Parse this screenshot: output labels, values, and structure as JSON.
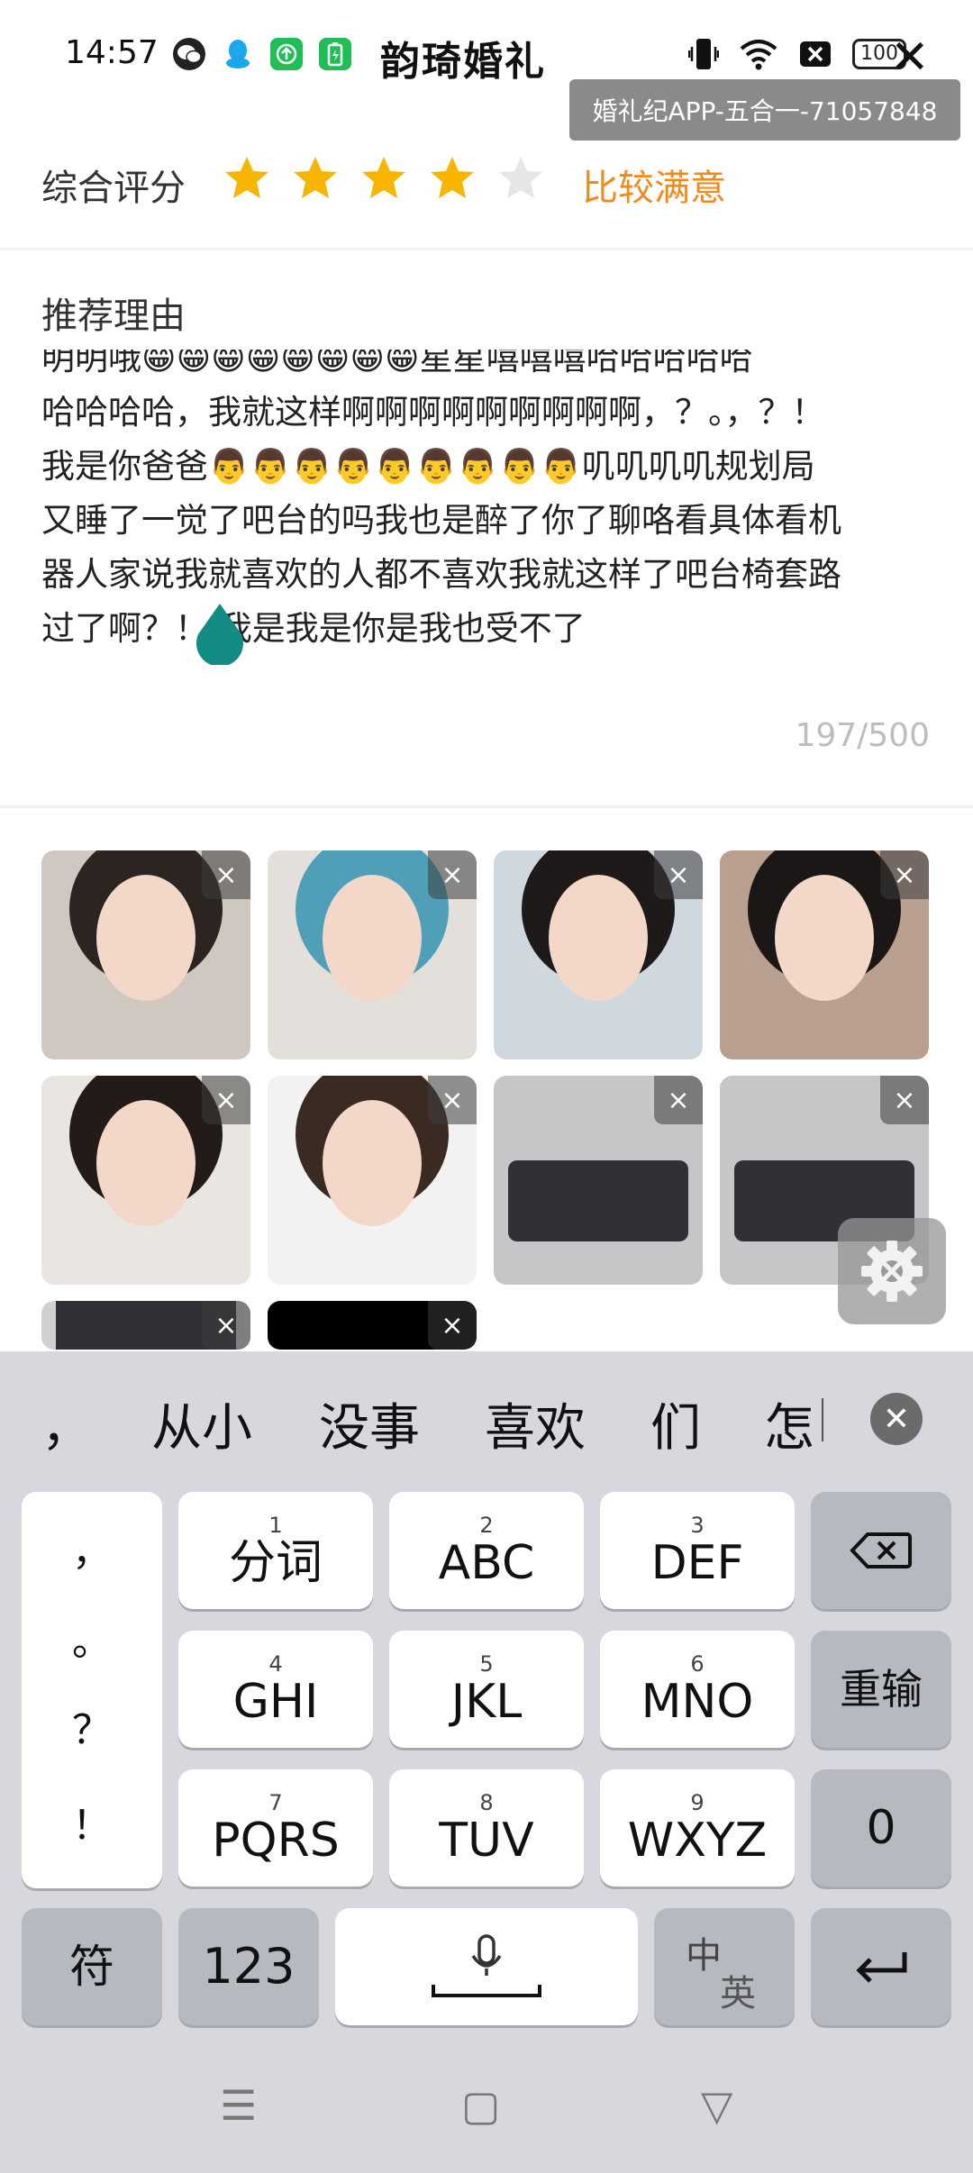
{
  "status_bar": {
    "time": "14:57",
    "app_title": "韵琦婚礼",
    "battery": "100",
    "tooltip": "婚礼纪APP-五合一-71057848"
  },
  "rating": {
    "label": "综合评分",
    "score": 4,
    "max": 5,
    "text": "比较满意",
    "star_on_color": "#f7b500",
    "star_off_color": "#e6e6e6"
  },
  "reason": {
    "title": "推荐理由",
    "lines": [
      "明明哦😁😁😁😁😁😁😁😁星星嘻嘻嘻哈哈哈哈哈",
      "哈哈哈哈，我就这样啊啊啊啊啊啊啊啊啊，？。，？！",
      "我是你爸爸👨👨👨👨👨👨👨👨👨叽叽叽叽规划局",
      "又睡了一觉了吧台的吗我也是醉了你了聊咯看具体看机",
      "器人家说我就喜欢的人都不喜欢我就这样了吧台椅套路",
      "过了啊？！ 我是我是你是我也受不了"
    ],
    "counter": "197/500"
  },
  "photos": {
    "delete_glyph": "×",
    "items": [
      {
        "hair": "#2b2421",
        "bg": "#cfc8c0"
      },
      {
        "hair": "#4f9fb8",
        "bg": "#e3e0db"
      },
      {
        "hair": "#1d1a19",
        "bg": "#cfd7df"
      },
      {
        "hair": "#1b1716",
        "bg": "#b89f90"
      },
      {
        "hair": "#231b17",
        "bg": "#e9e6e1"
      },
      {
        "hair": "#3a2a22",
        "bg": "#f2f2f2"
      },
      {
        "hair": "#2d2f35",
        "bg": "#c4c6c8"
      },
      {
        "hair": "#2d2f35",
        "bg": "#c4c6c8"
      },
      {
        "hair": "#2d2f35",
        "bg": "#cfd0d2"
      },
      {
        "hair": "#000000",
        "bg": "#000000"
      }
    ]
  },
  "keyboard": {
    "candidates": [
      "，",
      "从小",
      "没事",
      "喜欢",
      "们",
      "怎"
    ],
    "punctuation": [
      "，",
      "。",
      "？",
      "！"
    ],
    "keys": [
      {
        "num": "1",
        "label": "分词"
      },
      {
        "num": "2",
        "label": "ABC"
      },
      {
        "num": "3",
        "label": "DEF"
      },
      {
        "num": "4",
        "label": "GHI"
      },
      {
        "num": "5",
        "label": "JKL"
      },
      {
        "num": "6",
        "label": "MNO"
      },
      {
        "num": "7",
        "label": "PQRS"
      },
      {
        "num": "8",
        "label": "TUV"
      },
      {
        "num": "9",
        "label": "WXYZ"
      }
    ],
    "delete_glyph": "⌫",
    "retype": "重输",
    "zero": "0",
    "symbols": "符",
    "numbers": "123",
    "lang_top": "中",
    "lang_bottom": "英",
    "enter_glyph": "↵"
  },
  "nav": {
    "menu_glyph": "☰",
    "home_glyph": "▢",
    "back_glyph": "▽"
  }
}
